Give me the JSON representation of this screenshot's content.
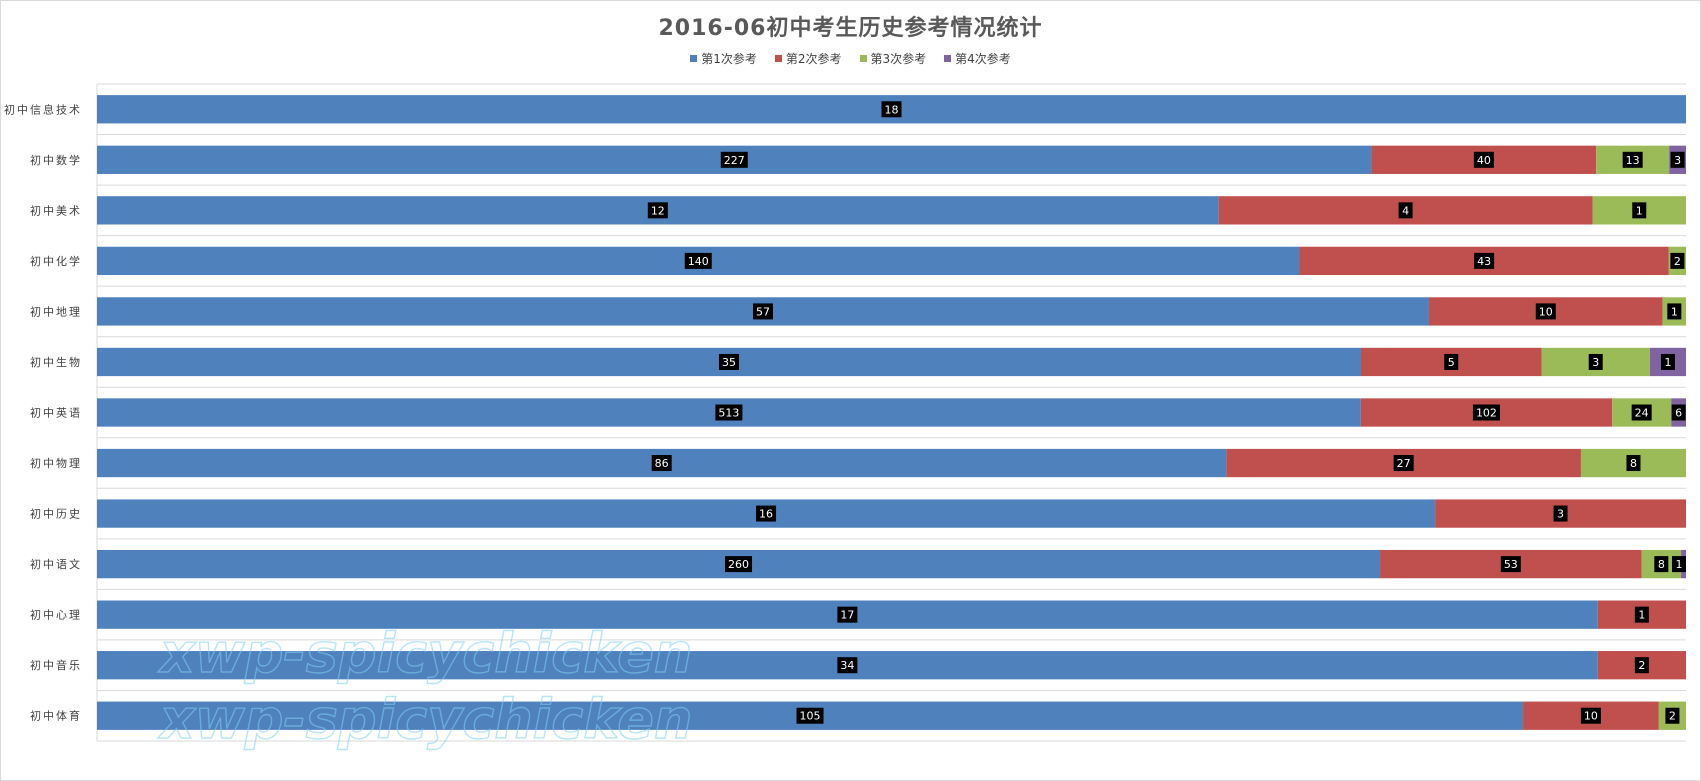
{
  "chart_data": {
    "type": "bar",
    "orientation": "horizontal",
    "stacking": "percent",
    "title": "2016-06初中考生历史参考情况统计",
    "legend_position": "top",
    "grid": true,
    "categories": [
      "初中信息技术",
      "初中数学",
      "初中美术",
      "初中化学",
      "初中地理",
      "初中生物",
      "初中英语",
      "初中物理",
      "初中历史",
      "初中语文",
      "初中心理",
      "初中音乐",
      "初中体育"
    ],
    "series": [
      {
        "name": "第1次参考",
        "color": "#4f81bd",
        "values": [
          18,
          227,
          12,
          140,
          57,
          35,
          513,
          86,
          16,
          260,
          17,
          34,
          105
        ]
      },
      {
        "name": "第2次参考",
        "color": "#c0504d",
        "values": [
          null,
          40,
          4,
          43,
          10,
          5,
          102,
          27,
          3,
          53,
          1,
          2,
          10
        ]
      },
      {
        "name": "第3次参考",
        "color": "#9bbb59",
        "values": [
          null,
          13,
          1,
          2,
          1,
          3,
          24,
          8,
          null,
          8,
          null,
          null,
          2
        ]
      },
      {
        "name": "第4次参考",
        "color": "#8064a2",
        "values": [
          null,
          3,
          null,
          null,
          null,
          1,
          6,
          null,
          null,
          1,
          null,
          null,
          null
        ]
      }
    ]
  },
  "watermark": {
    "text": "xwp-spicychicken"
  }
}
